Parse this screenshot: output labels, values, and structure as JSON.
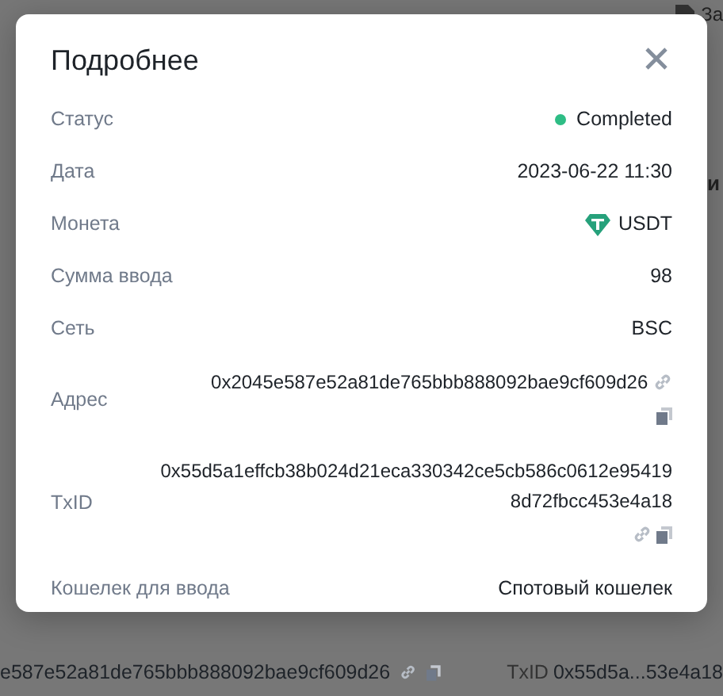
{
  "background": {
    "top_text": "За",
    "side_text": "и",
    "address": "e587e52a81de765bbb888092bae9cf609d26",
    "txid_label": "TxID",
    "txid_value": "0x55d5a...53e4a18"
  },
  "dialog": {
    "title": "Подробнее",
    "rows": [
      {
        "kind": "status",
        "label": "Статус",
        "value": "Completed",
        "color": "#2ebd85"
      },
      {
        "kind": "text",
        "label": "Дата",
        "value": "2023-06-22 11:30"
      },
      {
        "kind": "coin",
        "label": "Монета",
        "value": "USDT"
      },
      {
        "kind": "text",
        "label": "Сумма ввода",
        "value": "98"
      },
      {
        "kind": "text",
        "label": "Сеть",
        "value": "BSC"
      },
      {
        "kind": "address",
        "label": "Адрес",
        "value": "0x2045e587e52a81de765bbb888092bae9cf609d26"
      },
      {
        "kind": "txid",
        "label": "TxID",
        "value": "0x55d5a1effcb38b024d21eca330342ce5cb586c0612e954198d72fbcc453e4a18"
      },
      {
        "kind": "text",
        "label": "Кошелек для ввода",
        "value": "Спотовый кошелек"
      }
    ]
  }
}
